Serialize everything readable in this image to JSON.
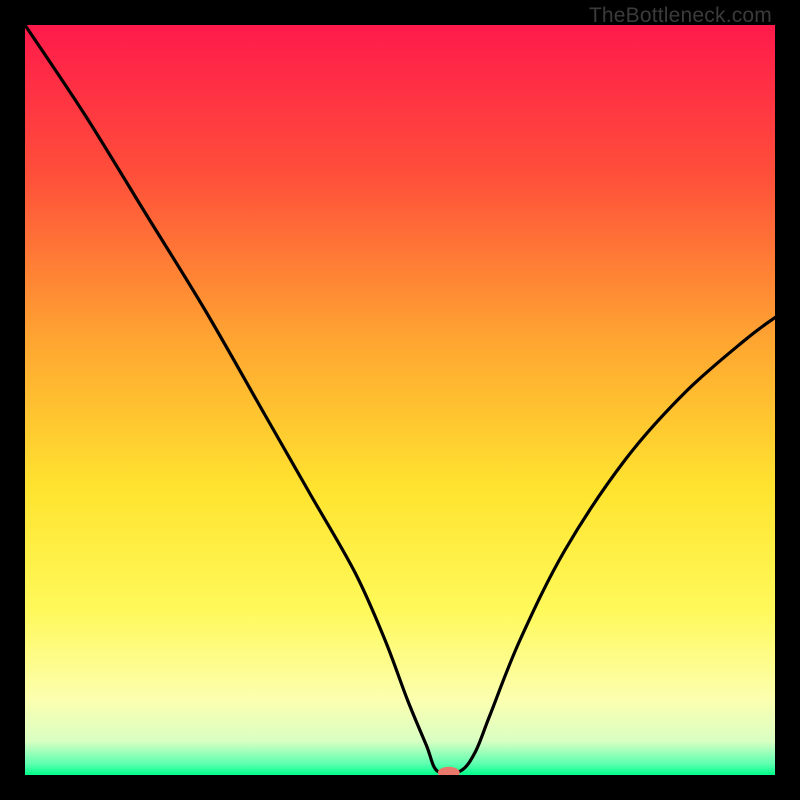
{
  "watermark": "TheBottleneck.com",
  "chart_data": {
    "type": "line",
    "title": "",
    "xlabel": "",
    "ylabel": "",
    "xlim": [
      0,
      100
    ],
    "ylim": [
      0,
      100
    ],
    "gradient_stops": [
      {
        "offset": 0.0,
        "color": "#ff1a4b"
      },
      {
        "offset": 0.2,
        "color": "#ff4f3a"
      },
      {
        "offset": 0.42,
        "color": "#ffa531"
      },
      {
        "offset": 0.62,
        "color": "#ffe42f"
      },
      {
        "offset": 0.78,
        "color": "#fff95a"
      },
      {
        "offset": 0.9,
        "color": "#fcffb0"
      },
      {
        "offset": 0.955,
        "color": "#d9ffc3"
      },
      {
        "offset": 0.985,
        "color": "#5dffb0"
      },
      {
        "offset": 1.0,
        "color": "#00ff88"
      }
    ],
    "series": [
      {
        "name": "bottleneck-curve",
        "x": [
          0.0,
          8.0,
          16.0,
          24.0,
          32.0,
          38.0,
          44.0,
          48.0,
          51.0,
          53.5,
          55.0,
          58.0,
          60.0,
          62.0,
          66.0,
          72.0,
          80.0,
          88.0,
          96.0,
          100.0
        ],
        "y": [
          100.0,
          88.0,
          75.0,
          62.0,
          48.0,
          37.5,
          27.0,
          18.0,
          10.0,
          4.0,
          0.5,
          0.5,
          3.0,
          8.0,
          18.0,
          30.0,
          42.0,
          51.0,
          58.0,
          61.0
        ]
      }
    ],
    "marker": {
      "name": "bottleneck-marker",
      "x": 56.5,
      "y": 0.3,
      "color": "#e9776c",
      "rx": 11,
      "ry": 6
    }
  }
}
